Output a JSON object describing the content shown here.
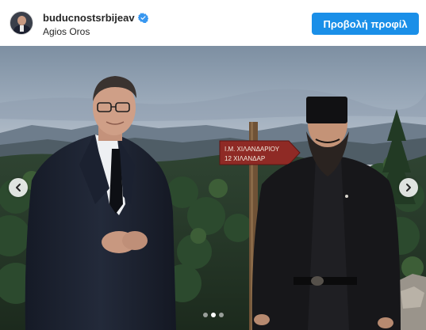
{
  "post": {
    "username": "buducnostsrbijeav",
    "location": "Agios Oros",
    "view_profile_label": "Προβολή προφίλ"
  },
  "photo": {
    "sign_line1": "I.M. ΧΙΛΑΝΔΑΡΙΟΥ",
    "sign_line2": "12 ΧΙΛΑΝΔΑΡ"
  },
  "carousel": {
    "current_slide": 2,
    "total_slides": 3
  },
  "colors": {
    "accent": "#1a8fe8",
    "verified": "#3897f0"
  },
  "icons": [
    "verified-badge-icon",
    "chevron-left-icon",
    "chevron-right-icon"
  ]
}
